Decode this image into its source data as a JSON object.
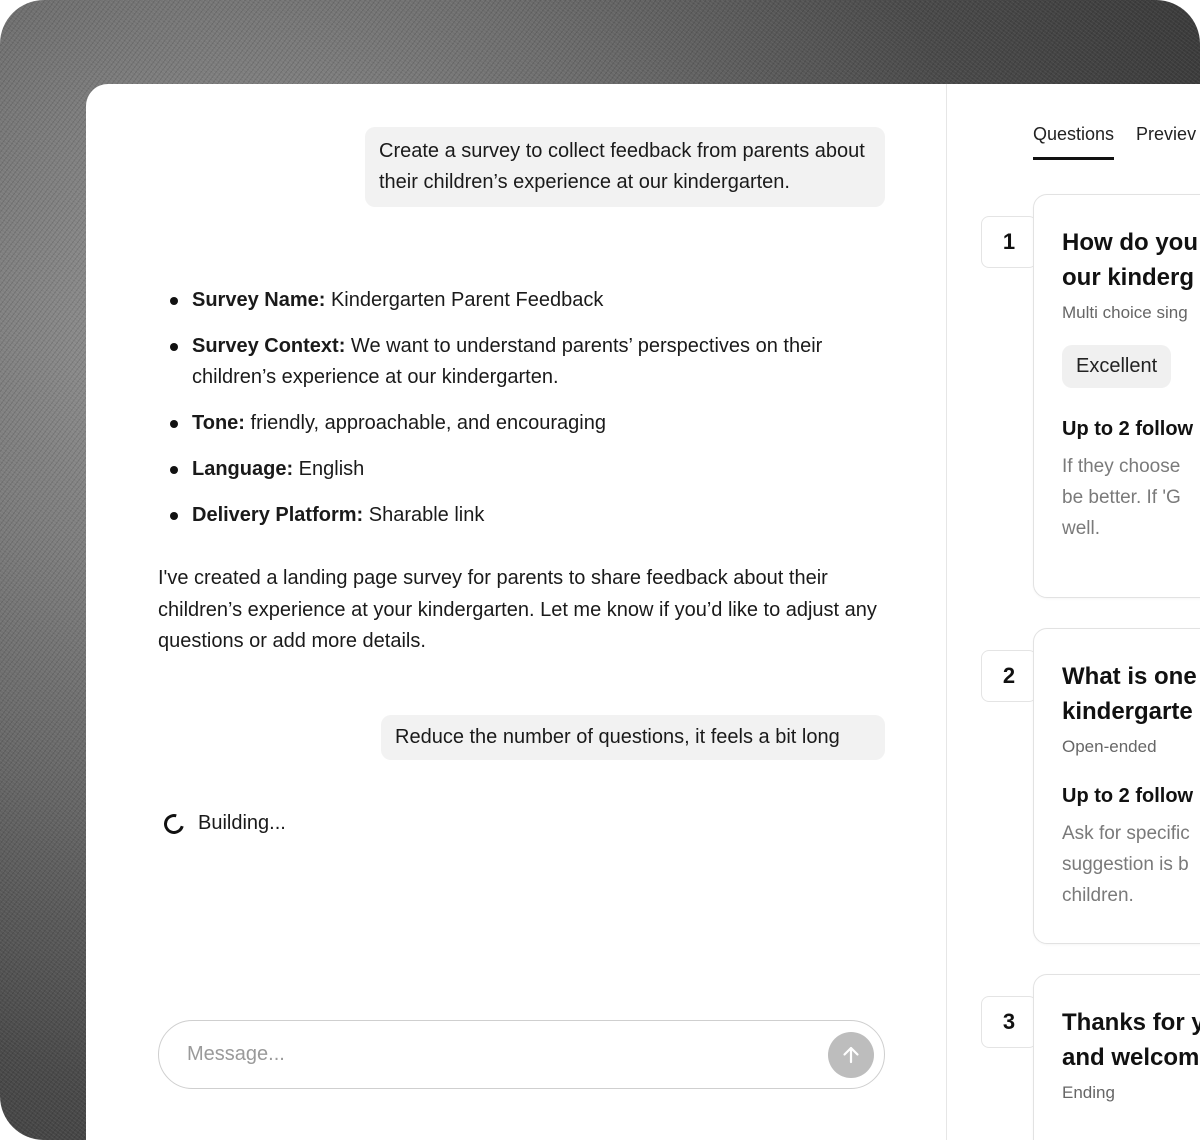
{
  "chat": {
    "messages": [
      {
        "role": "user",
        "text": "Create a survey to collect feedback from parents about their children’s experience at our kindergarten."
      },
      {
        "role": "user",
        "text": "Reduce the number of questions, it feels a bit long"
      }
    ],
    "summary": [
      {
        "label": "Survey Name:",
        "value": " Kindergarten Parent Feedback"
      },
      {
        "label": "Survey Context:",
        "value": " We want to understand parents’ perspectives on their children’s experience at our kindergarten."
      },
      {
        "label": "Tone:",
        "value": " friendly, approachable, and encouraging"
      },
      {
        "label": "Language:",
        "value": " English"
      },
      {
        "label": "Delivery Platform:",
        "value": " Sharable link"
      }
    ],
    "assistant_reply": "I've created a landing page survey for parents to share feedback about their children’s experience at your kindergarten. Let me know if you’d like to adjust any questions or add more details.",
    "status": "Building...",
    "composer_placeholder": "Message..."
  },
  "panel": {
    "tabs": [
      "Questions",
      "Previev"
    ],
    "active_tab": "Questions",
    "questions": [
      {
        "number": "1",
        "title": "How do you\nour kinderg",
        "type": "Multi choice sing",
        "chip": "Excellent",
        "followup_label": "Up to 2 follow",
        "followup_text": "If they choose\nbe better. If 'G\nwell."
      },
      {
        "number": "2",
        "title": "What is one\nkindergarte",
        "type": "Open-ended",
        "followup_label": "Up to 2 follow",
        "followup_text": "Ask for specific\nsuggestion is b\nchildren."
      },
      {
        "number": "3",
        "title": "Thanks for y\nand welcom",
        "type": "Ending"
      }
    ]
  }
}
